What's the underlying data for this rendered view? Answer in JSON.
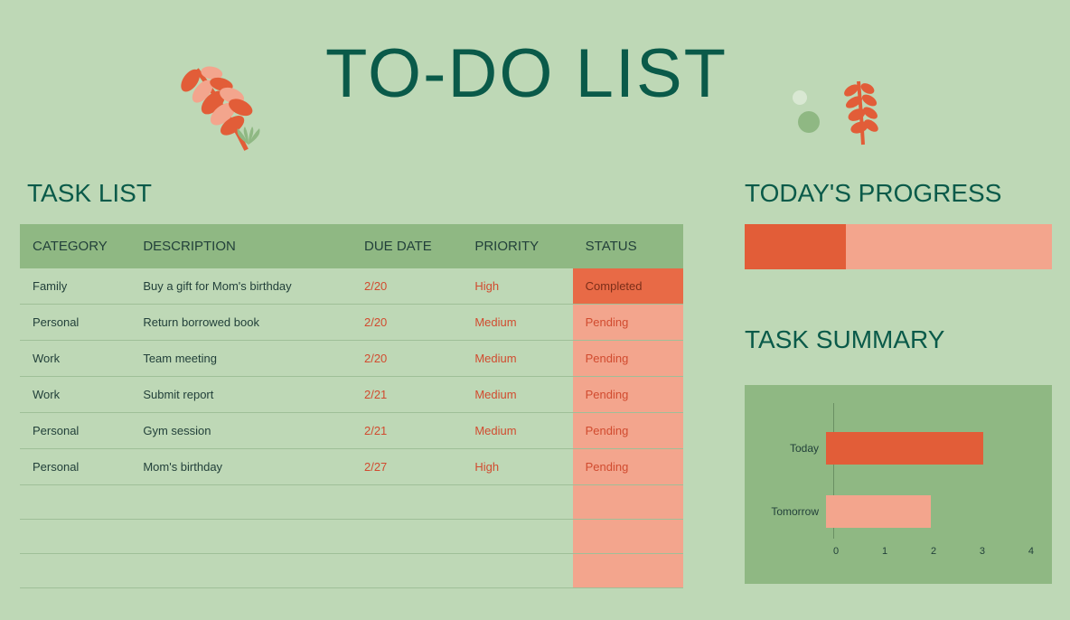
{
  "title": "TO-DO LIST",
  "sections": {
    "task_list": "TASK LIST",
    "progress": "TODAY'S PROGRESS",
    "summary": "TASK SUMMARY"
  },
  "columns": {
    "category": "CATEGORY",
    "description": "DESCRIPTION",
    "due": "DUE DATE",
    "priority": "PRIORITY",
    "status": "STATUS"
  },
  "tasks": [
    {
      "category": "Family",
      "description": "Buy a gift for Mom's birthday",
      "due": "2/20",
      "priority": "High",
      "status": "Completed"
    },
    {
      "category": "Personal",
      "description": "Return borrowed book",
      "due": "2/20",
      "priority": "Medium",
      "status": "Pending"
    },
    {
      "category": "Work",
      "description": "Team meeting",
      "due": "2/20",
      "priority": "Medium",
      "status": "Pending"
    },
    {
      "category": "Work",
      "description": "Submit report",
      "due": "2/21",
      "priority": "Medium",
      "status": "Pending"
    },
    {
      "category": "Personal",
      "description": "Gym session",
      "due": "2/21",
      "priority": "Medium",
      "status": "Pending"
    },
    {
      "category": "Personal",
      "description": "Mom's birthday",
      "due": "2/27",
      "priority": "High",
      "status": "Pending"
    }
  ],
  "progress": {
    "percent": 33
  },
  "chart_data": {
    "type": "bar",
    "orientation": "horizontal",
    "categories": [
      "Today",
      "Tomorrow"
    ],
    "series": [
      {
        "name": "Today",
        "value": 3,
        "color": "#e25d38"
      },
      {
        "name": "Tomorrow",
        "value": 2,
        "color": "#f3a58d"
      }
    ],
    "xlim": [
      0,
      4
    ],
    "ticks": [
      0,
      1,
      2,
      3,
      4
    ],
    "title": "",
    "xlabel": "",
    "ylabel": ""
  }
}
